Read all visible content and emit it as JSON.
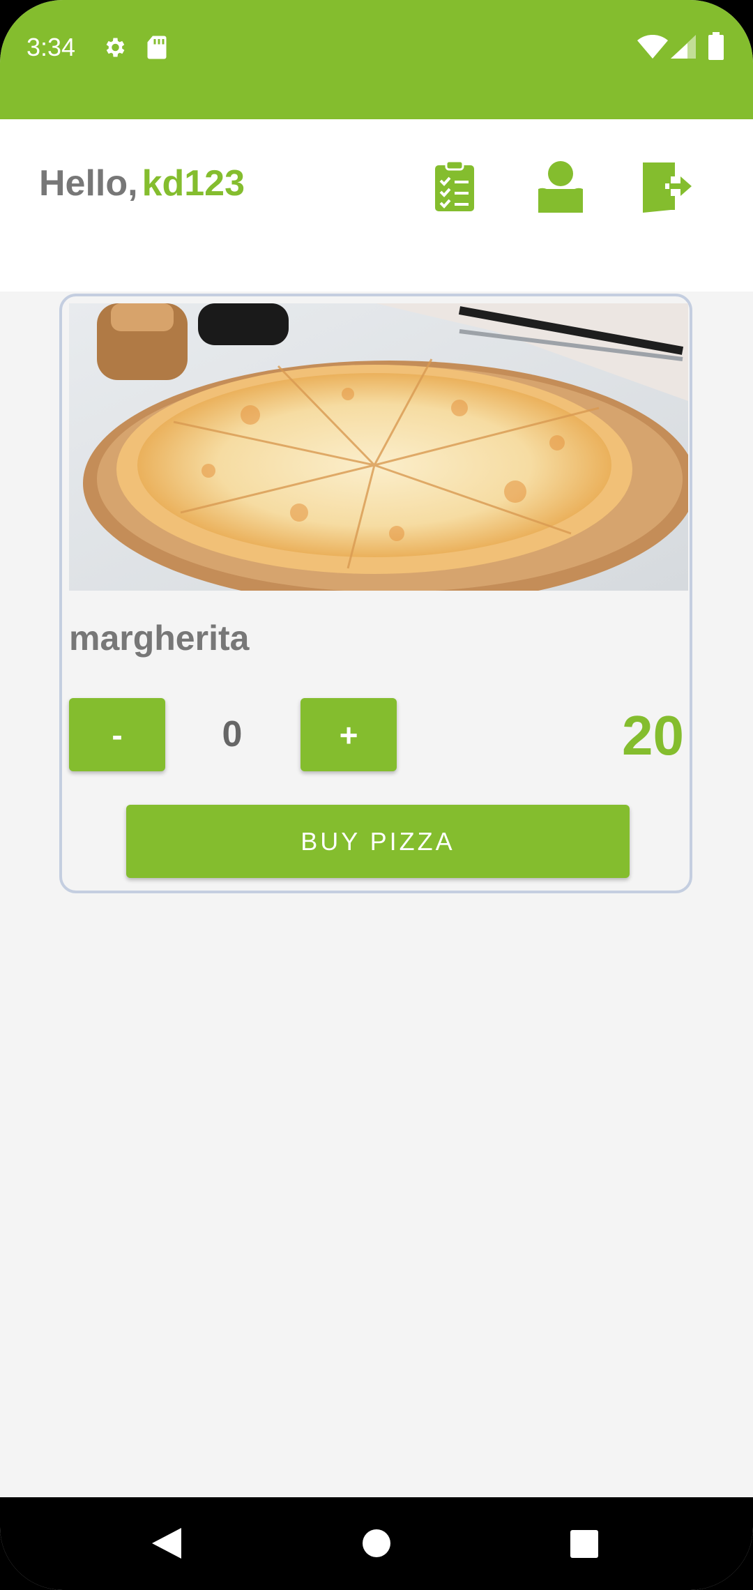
{
  "status_bar": {
    "time": "3:34",
    "icons": [
      "gear-icon",
      "sd-card-icon",
      "wifi-icon",
      "signal-icon",
      "battery-icon"
    ]
  },
  "header": {
    "greeting": "Hello,",
    "username": "kd123",
    "actions": [
      "orders-clipboard-icon",
      "profile-icon",
      "logout-icon"
    ]
  },
  "product": {
    "name": "margherita",
    "quantity": "0",
    "minus_label": "-",
    "plus_label": "+",
    "price": "20",
    "buy_label": "BUY PIZZA"
  },
  "nav_bar": {
    "buttons": [
      "back-icon",
      "home-icon",
      "recents-icon"
    ]
  },
  "colors": {
    "accent": "#84bd2e",
    "header_bg": "#ffffff",
    "content_bg": "#f4f4f4",
    "text_gray": "#777777",
    "card_border": "#c4cee0"
  }
}
